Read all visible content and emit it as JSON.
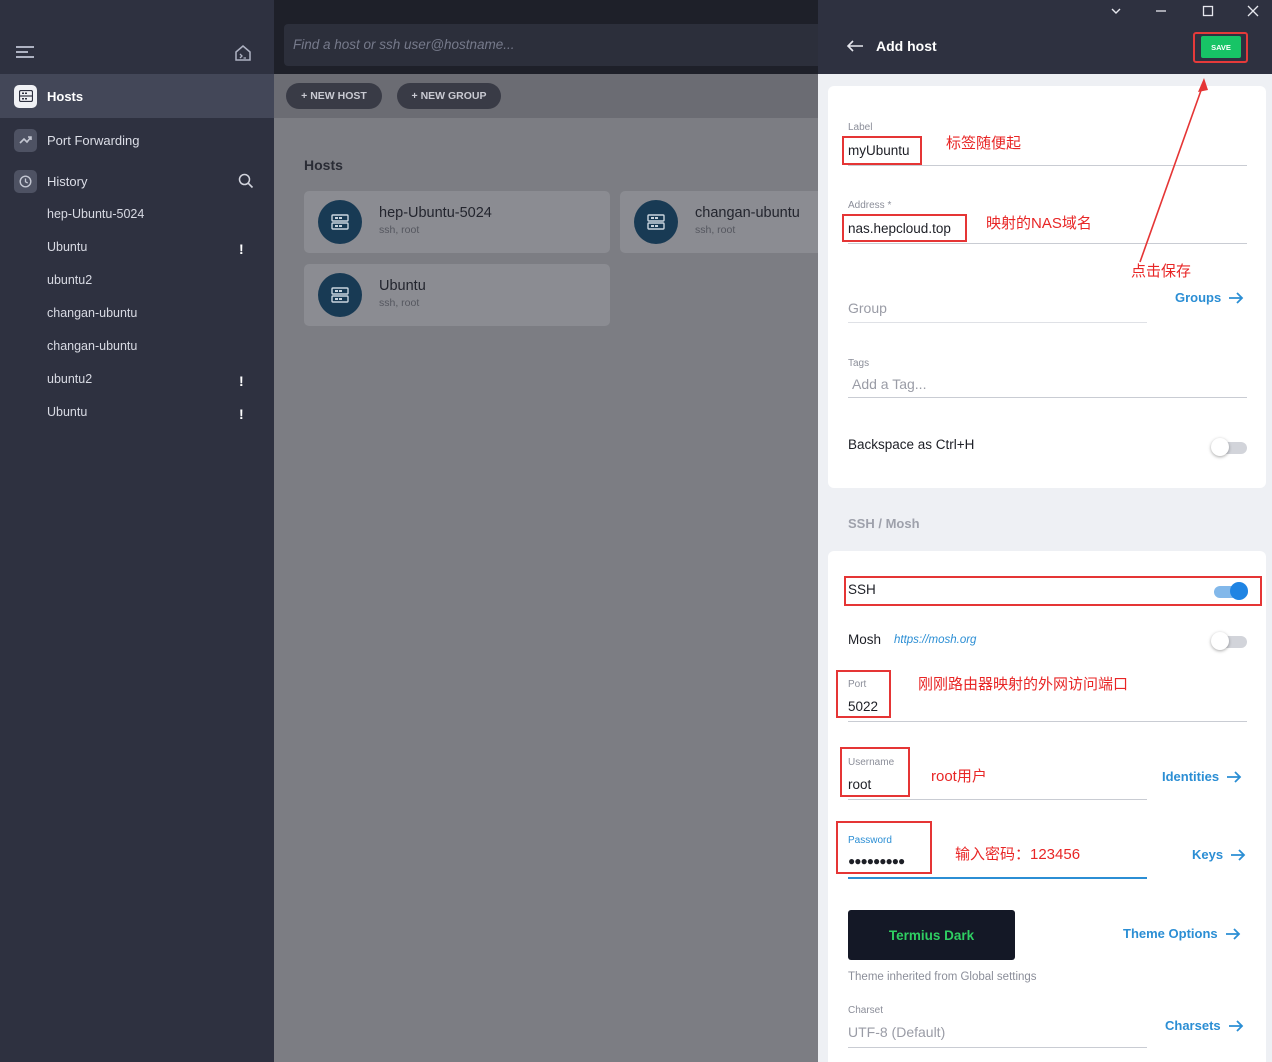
{
  "sidebar": {
    "nav": [
      {
        "label": "Hosts",
        "icon": "hosts-icon"
      },
      {
        "label": "Port Forwarding",
        "icon": "port-forwarding-icon"
      },
      {
        "label": "History",
        "icon": "history-icon"
      }
    ],
    "history": [
      {
        "label": "hep-Ubuntu-5024",
        "warning": ""
      },
      {
        "label": "Ubuntu",
        "warning": "!"
      },
      {
        "label": "ubuntu2",
        "warning": ""
      },
      {
        "label": "changan-ubuntu",
        "warning": ""
      },
      {
        "label": "changan-ubuntu",
        "warning": ""
      },
      {
        "label": "ubuntu2",
        "warning": "!"
      },
      {
        "label": "Ubuntu",
        "warning": "!"
      }
    ]
  },
  "main": {
    "search_placeholder": "Find a host or ssh user@hostname...",
    "new_host": "+ NEW HOST",
    "new_group": "+ NEW GROUP",
    "hosts_title": "Hosts",
    "hosts": [
      {
        "name": "hep-Ubuntu-5024",
        "sub": "ssh, root"
      },
      {
        "name": "changan-ubuntu",
        "sub": "ssh, root"
      },
      {
        "name": "Ubuntu",
        "sub": "ssh, root"
      }
    ]
  },
  "panel": {
    "title": "Add host",
    "save": "SAVE",
    "label_caption": "Label",
    "label_value": "myUbuntu",
    "address_caption": "Address *",
    "address_value": "nas.hepcloud.top",
    "group_placeholder": "Group",
    "groups_link": "Groups",
    "tags_caption": "Tags",
    "tags_placeholder": "Add a Tag...",
    "backspace_label": "Backspace as Ctrl+H",
    "backspace_on": false,
    "ssh_section": "SSH / Mosh",
    "ssh_label": "SSH",
    "ssh_on": true,
    "mosh_label": "Mosh",
    "mosh_link": "https://mosh.org",
    "mosh_on": false,
    "port_caption": "Port",
    "port_value": "5022",
    "username_caption": "Username",
    "username_value": "root",
    "identities_link": "Identities",
    "password_caption": "Password",
    "password_value": "●●●●●●●●●",
    "keys_link": "Keys",
    "theme_name": "Termius Dark",
    "theme_options_link": "Theme Options",
    "theme_note": "Theme inherited from Global settings",
    "charset_caption": "Charset",
    "charset_placeholder": "UTF-8 (Default)",
    "charsets_link": "Charsets"
  },
  "annotations": {
    "label_note": "标签随便起",
    "address_note": "映射的NAS域名",
    "save_note": "点击保存",
    "port_note": "刚刚路由器映射的外网访问端口",
    "username_note": "root用户",
    "password_note": "输入密码：123456"
  },
  "colors": {
    "accent": "#2b8ed4",
    "save": "#17c466",
    "annotation": "#e53535",
    "sidebar": "#2e3140"
  }
}
